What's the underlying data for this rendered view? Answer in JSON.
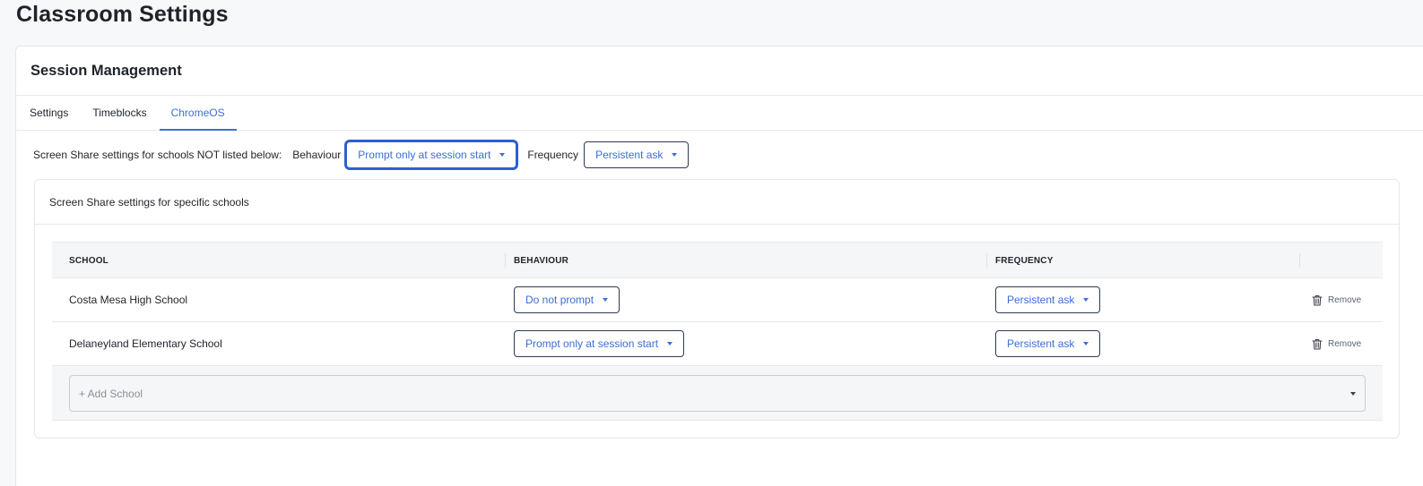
{
  "page": {
    "title": "Classroom Settings"
  },
  "card": {
    "title": "Session Management"
  },
  "tabs": [
    {
      "label": "Settings",
      "active": false
    },
    {
      "label": "Timeblocks",
      "active": false
    },
    {
      "label": "ChromeOS",
      "active": true
    }
  ],
  "default_settings": {
    "description": "Screen Share settings for schools NOT listed below:",
    "behaviour_label": "Behaviour",
    "behaviour_value": "Prompt only at session start",
    "frequency_label": "Frequency",
    "frequency_value": "Persistent ask"
  },
  "specific": {
    "title": "Screen Share settings for specific schools",
    "columns": [
      "SCHOOL",
      "BEHAVIOUR",
      "FREQUENCY",
      ""
    ],
    "rows": [
      {
        "school": "Costa Mesa High School",
        "behaviour": "Do not prompt",
        "frequency": "Persistent ask",
        "remove_label": "Remove"
      },
      {
        "school": "Delaneyland Elementary School",
        "behaviour": "Prompt only at session start",
        "frequency": "Persistent ask",
        "remove_label": "Remove"
      }
    ],
    "add_placeholder": "+ Add School"
  },
  "colors": {
    "accent": "#3b6fd6",
    "text": "#1f2329",
    "border": "#e3e6ea",
    "page_bg": "#f7f8fa"
  },
  "icons": {
    "caret": "chevron-down-icon",
    "remove": "trash-icon"
  }
}
